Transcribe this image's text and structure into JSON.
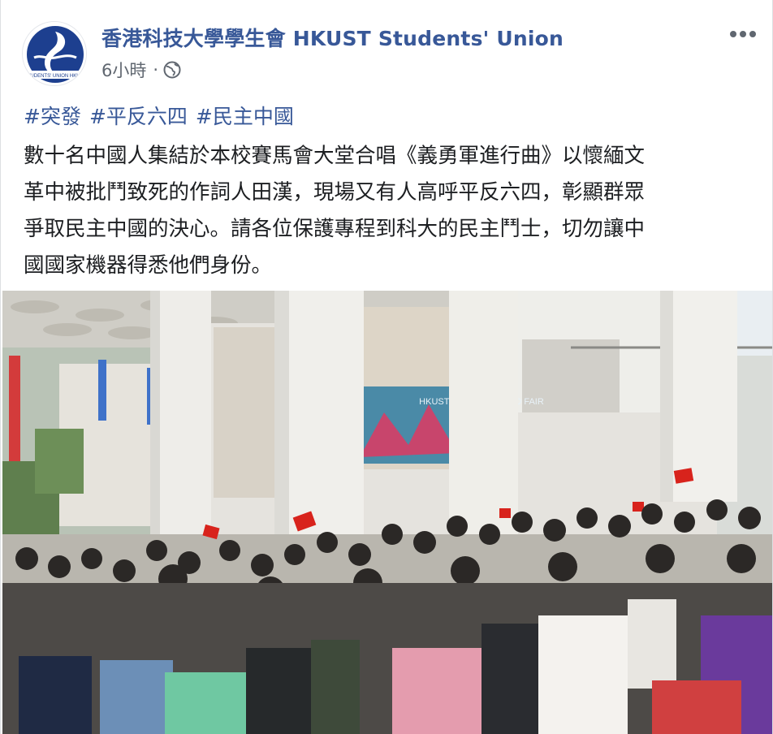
{
  "post": {
    "page_name": "香港科技大學學生會 HKUST Students' Union",
    "timestamp": "6小時",
    "separator": "·",
    "privacy_icon": "globe-icon",
    "more_icon": "more-horizontal-icon",
    "hashtags": [
      "#突發",
      "#平反六四",
      "#民主中國"
    ],
    "body_lines": [
      "數十名中國人集結於本校賽馬會大堂合唱《義勇軍進行曲》以懷緬文",
      "革中被批鬥致死的作詞人田漢，現場又有人高呼平反六四，彰顯群眾",
      "爭取民主中國的決心。請各位保護專程到科大的民主鬥士，切勿讓中",
      "國國家機器得悉他們身份。"
    ],
    "photo_text": {
      "banner": "HKUST STUDY ABROAD FAIR"
    },
    "avatar_text": "STUDENTS' UNION HKUST"
  },
  "colors": {
    "link": "#385898",
    "text": "#1c1e21",
    "meta": "#606770",
    "avatar_blue": "#1d3f8f"
  }
}
